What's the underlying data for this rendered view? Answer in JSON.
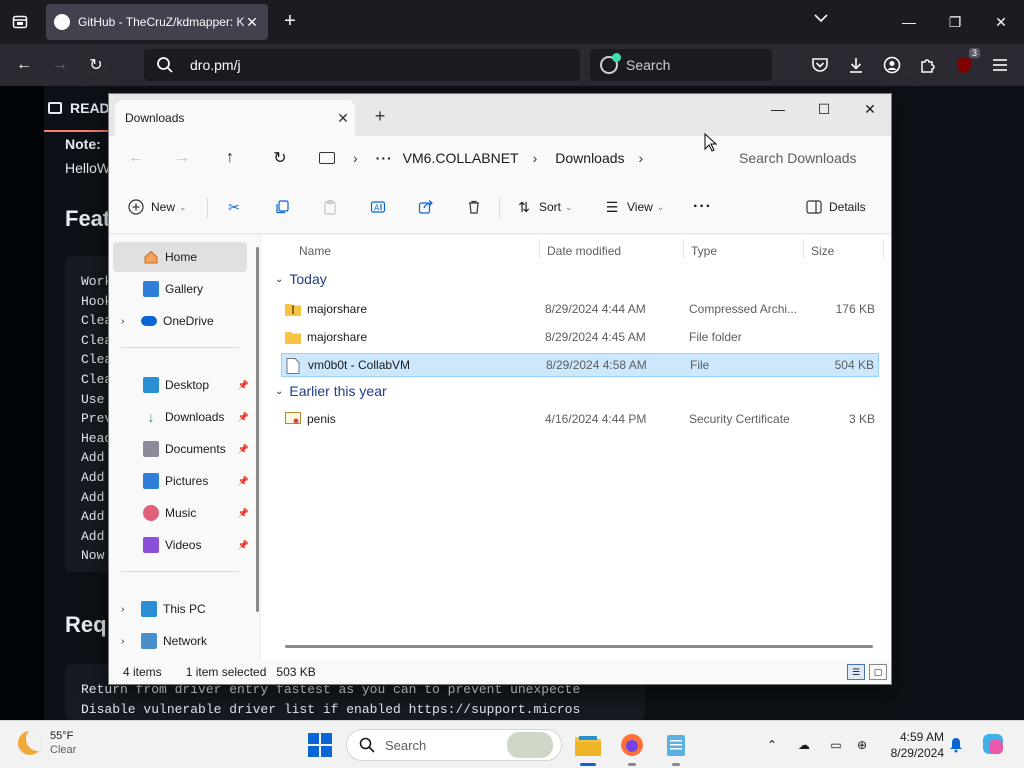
{
  "browser": {
    "tab_title": "GitHub - TheCruZ/kdmapper: K",
    "url": "dro.pm/j",
    "search_placeholder": "Search",
    "ublock_count": "3"
  },
  "github": {
    "readme_tab": "READ",
    "note": "Note:",
    "hello": "HelloW",
    "h2_features": "Feat",
    "code_lines": [
      "Work",
      "Hook",
      "Clea",
      "Clea",
      "Clea",
      "Clea",
      "Use",
      "Prev",
      "Head",
      "Add",
      "Add",
      "Add",
      "Add",
      "Add",
      "Now"
    ],
    "h2_requirements": "Req",
    "bottom_code": [
      "Return from driver entry fastest as you can to prevent unexpecte",
      "Disable vulnerable driver list if enabled https://support.micros"
    ]
  },
  "explorer": {
    "tab_title": "Downloads",
    "breadcrumb": [
      "VM6.COLLABNET",
      "Downloads"
    ],
    "search_placeholder": "Search Downloads",
    "toolbar": {
      "new_label": "New",
      "sort_label": "Sort",
      "view_label": "View",
      "details_label": "Details"
    },
    "nav_pane": {
      "home": "Home",
      "gallery": "Gallery",
      "onedrive": "OneDrive",
      "desktop": "Desktop",
      "downloads": "Downloads",
      "documents": "Documents",
      "pictures": "Pictures",
      "music": "Music",
      "videos": "Videos",
      "this_pc": "This PC",
      "network": "Network"
    },
    "columns": {
      "name": "Name",
      "date": "Date modified",
      "type": "Type",
      "size": "Size"
    },
    "groups": {
      "today": "Today",
      "earlier": "Earlier this year"
    },
    "files": [
      {
        "name": "majorshare",
        "date": "8/29/2024 4:44 AM",
        "type": "Compressed Archi...",
        "size": "176 KB"
      },
      {
        "name": "majorshare",
        "date": "8/29/2024 4:45 AM",
        "type": "File folder",
        "size": ""
      },
      {
        "name": "vm0b0t - CollabVM",
        "date": "8/29/2024 4:58 AM",
        "type": "File",
        "size": "504 KB"
      },
      {
        "name": "penis",
        "date": "4/16/2024 4:44 PM",
        "type": "Security Certificate",
        "size": "3 KB"
      }
    ],
    "status": {
      "items": "4 items",
      "selected": "1 item selected",
      "size": "503 KB"
    }
  },
  "taskbar": {
    "temperature": "55°F",
    "weather": "Clear",
    "search_label": "Search",
    "time": "4:59 AM",
    "date": "8/29/2024"
  },
  "colors": {
    "accent": "#0a64d6",
    "selection": "#cce8ff",
    "folder": "#f6c342",
    "github_bg": "#0d1117",
    "firefox_chrome": "#1c1b22"
  }
}
